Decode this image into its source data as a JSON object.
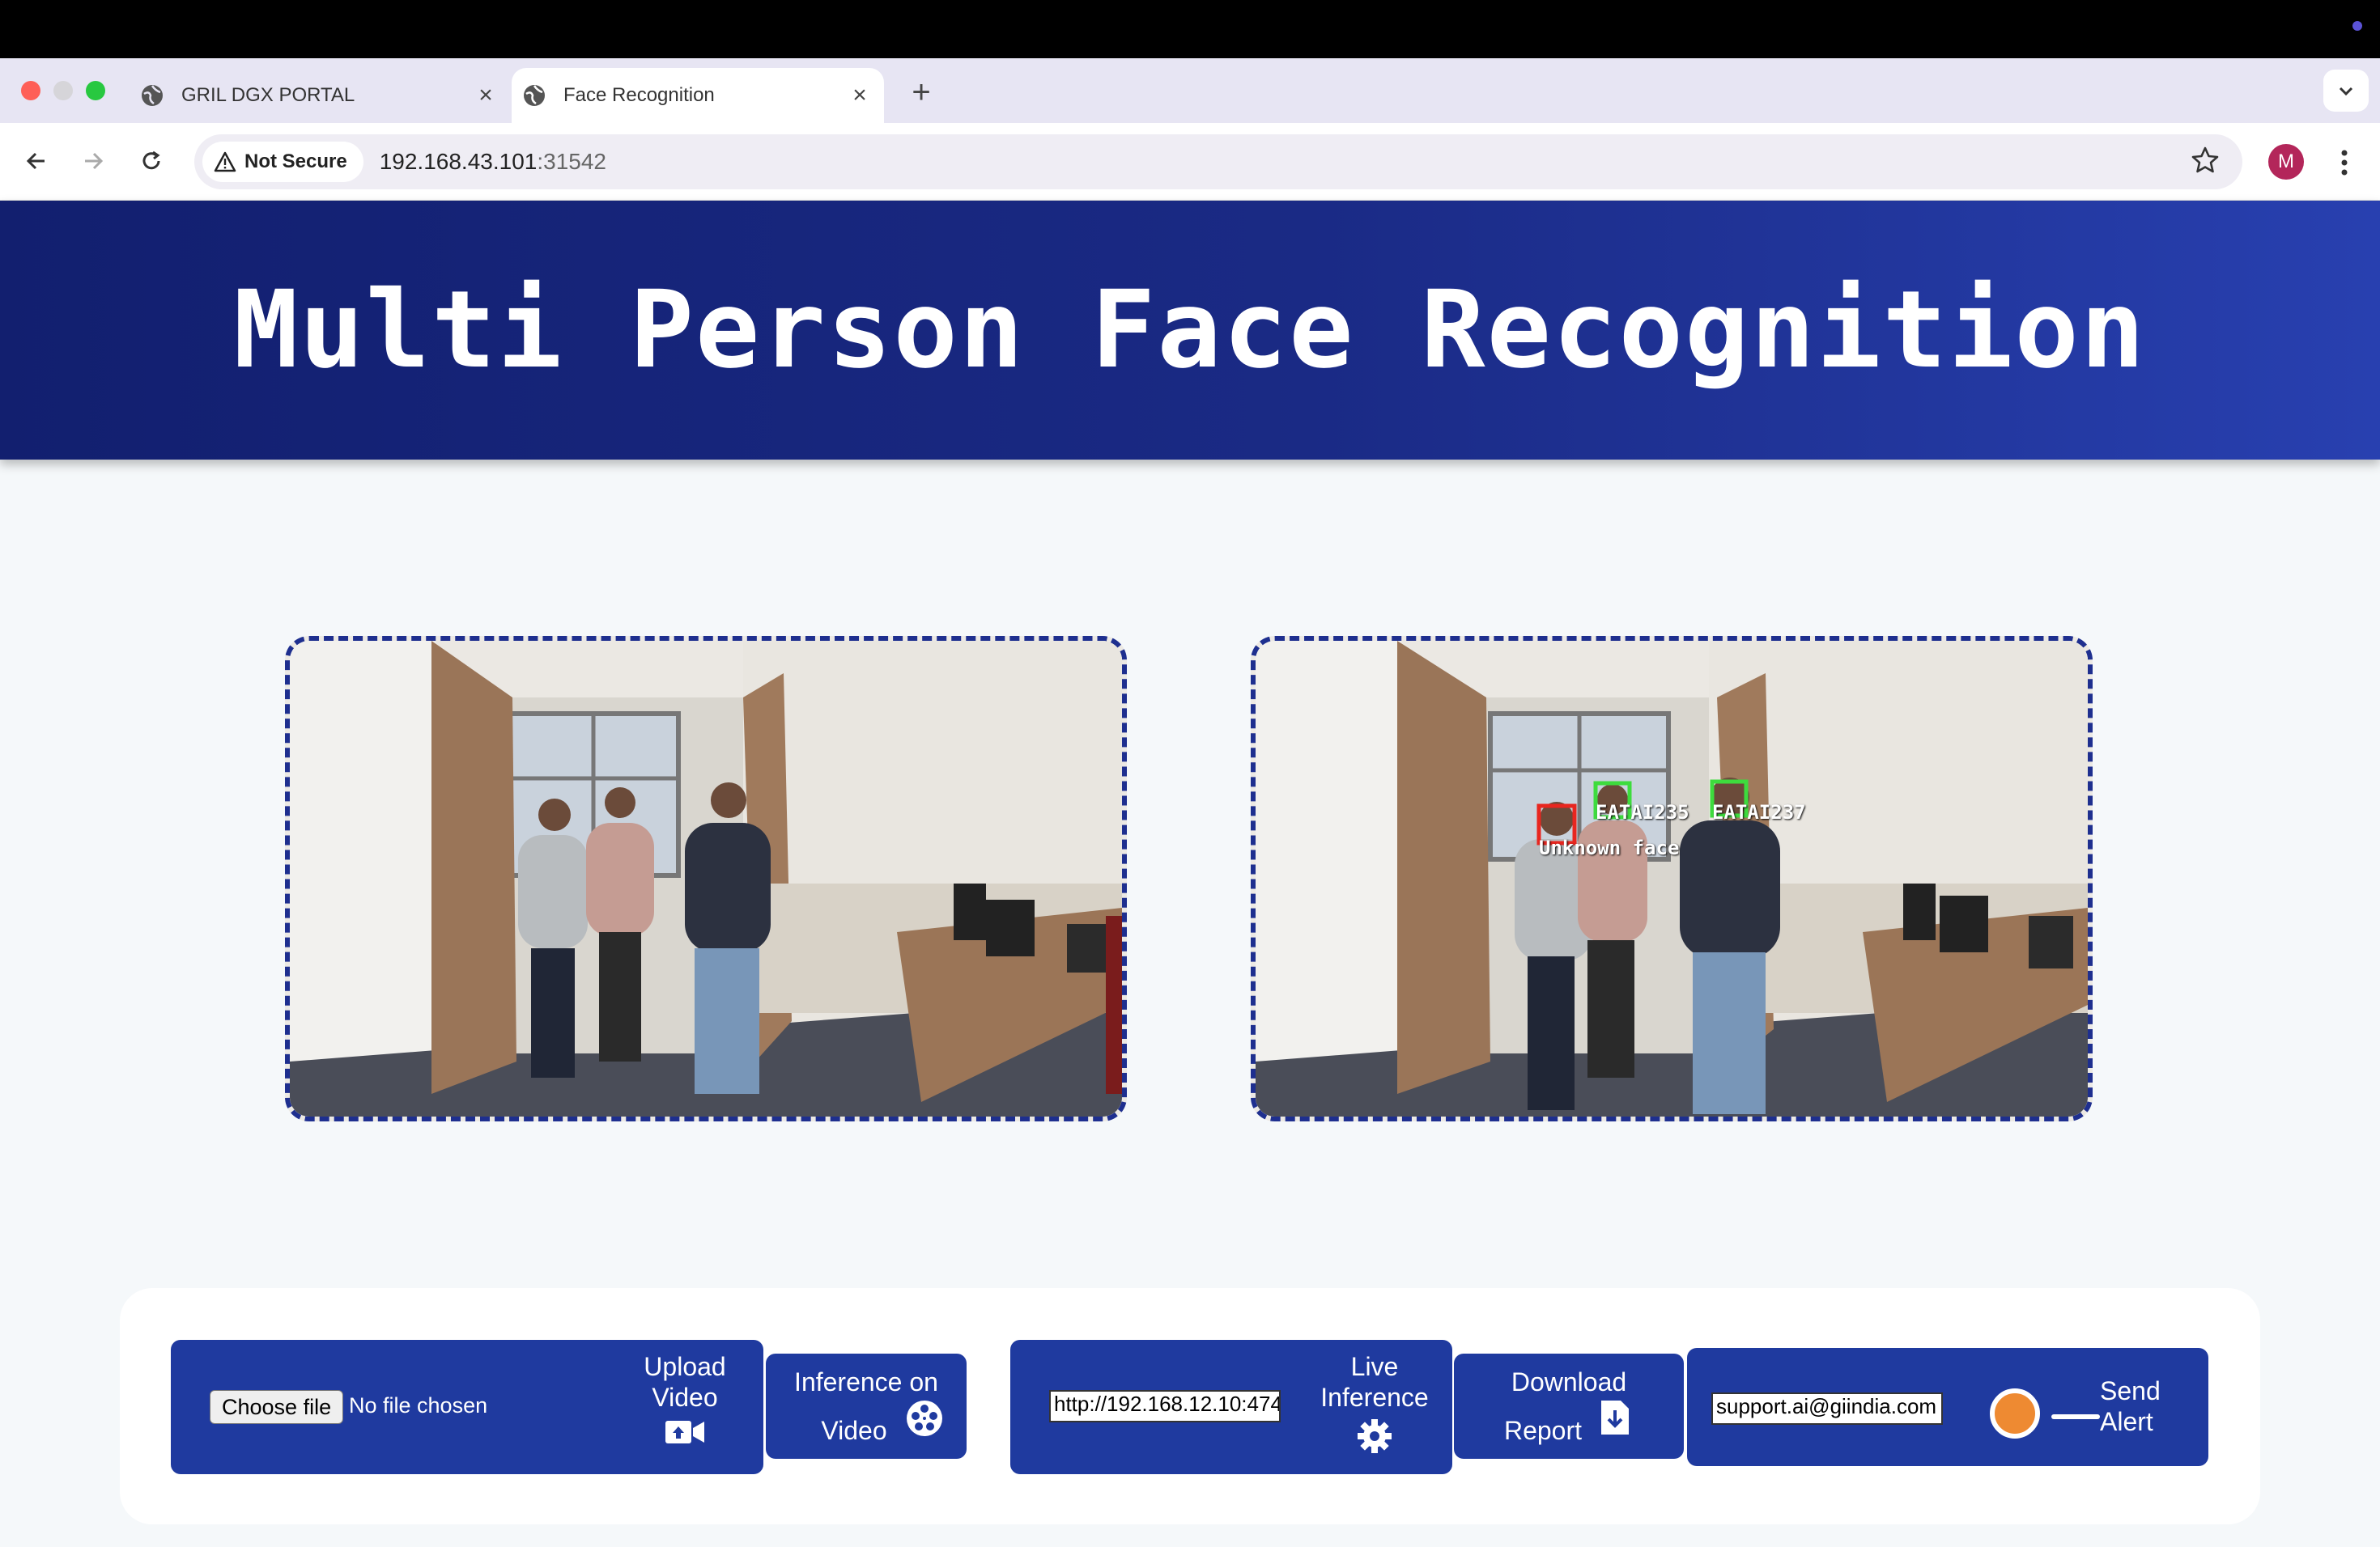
{
  "browser": {
    "tabs": [
      {
        "title": "GRIL DGX PORTAL",
        "active": false
      },
      {
        "title": "Face Recognition",
        "active": true
      }
    ],
    "security_label": "Not Secure",
    "url_host": "192.168.43.101",
    "url_port": ":31542",
    "profile_initial": "M"
  },
  "page": {
    "title": "Multi Person Face Recognition"
  },
  "video_panels": {
    "input": {
      "name": "input-video"
    },
    "output": {
      "name": "output-video",
      "detections": [
        {
          "label": "EATAI235",
          "color": "#3ddc3d"
        },
        {
          "label": "EATAI237",
          "color": "#3ddc3d"
        },
        {
          "label": "Unknown face",
          "color": "#e8261f"
        }
      ]
    }
  },
  "controls": {
    "upload": {
      "file_button": "Choose file",
      "file_status": "No file chosen",
      "label_line1": "Upload",
      "label_line2": "Video"
    },
    "inference": {
      "label_line1": "Inference on",
      "label_line2": "Video"
    },
    "live": {
      "stream_url_value": "http://192.168.12.10:474",
      "label_line1": "Live",
      "label_line2": "Inference"
    },
    "report": {
      "label_line1": "Download",
      "label_line2": "Report"
    },
    "alert": {
      "email_value": "support.ai@giindia.com",
      "label_line1": "Send",
      "label_line2": "Alert",
      "toggle_color": "#ee8a32"
    }
  },
  "colors": {
    "header_bg": "#121f6f",
    "control_bg": "#1f3a9f",
    "panel_border": "#1e2f8f"
  }
}
